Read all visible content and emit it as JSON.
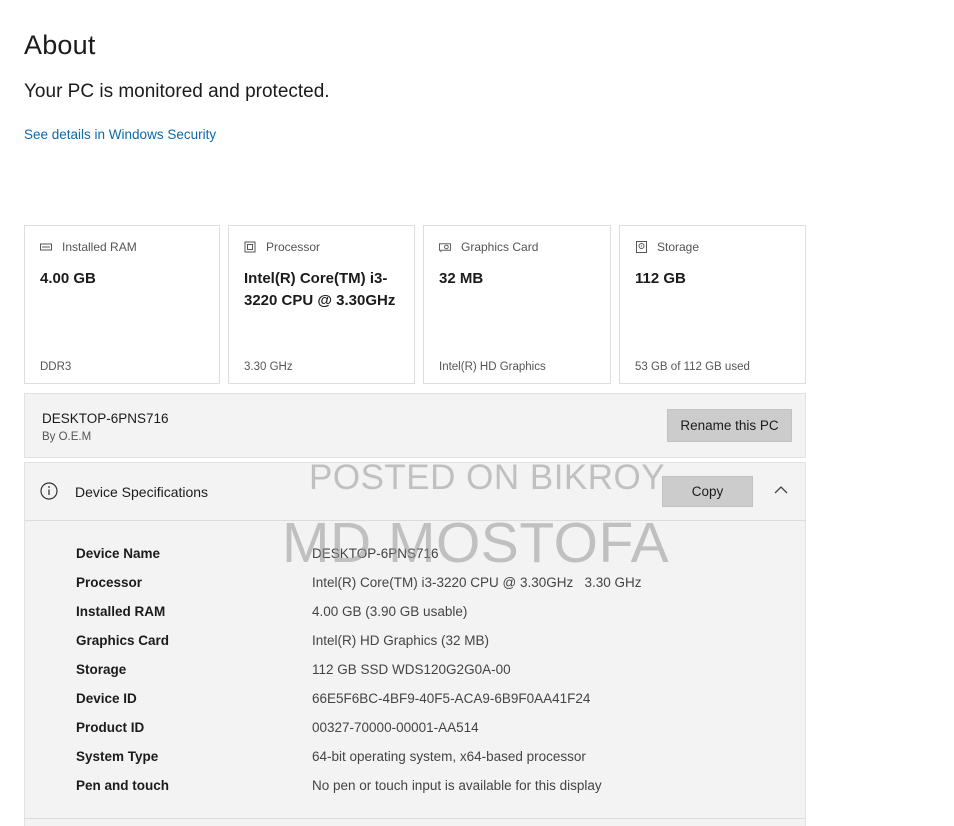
{
  "header": {
    "title": "About",
    "status": "Your PC is monitored and protected.",
    "security_link": "See details in Windows Security"
  },
  "cards": [
    {
      "label": "Installed RAM",
      "value": "4.00 GB",
      "footer": "DDR3",
      "icon": "memory-icon"
    },
    {
      "label": "Processor",
      "value": "Intel(R) Core(TM) i3-3220 CPU @ 3.30GHz",
      "footer": "3.30 GHz",
      "icon": "processor-icon"
    },
    {
      "label": "Graphics Card",
      "value": "32 MB",
      "footer": "Intel(R) HD Graphics",
      "icon": "graphics-card-icon"
    },
    {
      "label": "Storage",
      "value": "112 GB",
      "footer": "53 GB of 112 GB used",
      "icon": "storage-icon"
    }
  ],
  "pc": {
    "name": "DESKTOP-6PNS716",
    "by": "By O.E.M",
    "rename_label": "Rename this PC"
  },
  "specs": {
    "title": "Device Specifications",
    "copy_label": "Copy",
    "rows": [
      {
        "label": "Device Name",
        "value": "DESKTOP-6PNS716"
      },
      {
        "label": "Processor",
        "value": "Intel(R) Core(TM) i3-3220 CPU @ 3.30GHz   3.30 GHz"
      },
      {
        "label": "Installed RAM",
        "value": "4.00 GB (3.90 GB usable)"
      },
      {
        "label": "Graphics Card",
        "value": "Intel(R) HD Graphics (32 MB)"
      },
      {
        "label": "Storage",
        "value": "112 GB SSD WDS120G2G0A-00"
      },
      {
        "label": "Device ID",
        "value": "66E5F6BC-4BF9-40F5-ACA9-6B9F0AA41F24"
      },
      {
        "label": "Product ID",
        "value": "00327-70000-00001-AA514"
      },
      {
        "label": "System Type",
        "value": "64-bit operating system, x64-based processor"
      },
      {
        "label": "Pen and touch",
        "value": "No pen or touch input is available for this display"
      }
    ]
  },
  "watermark": {
    "line1": "POSTED ON BIKROY",
    "line2": "MD MOSTOFA"
  },
  "colors": {
    "link": "#0b6aa8",
    "panel_bg": "#f3f3f3",
    "button_bg": "#cccccc"
  }
}
